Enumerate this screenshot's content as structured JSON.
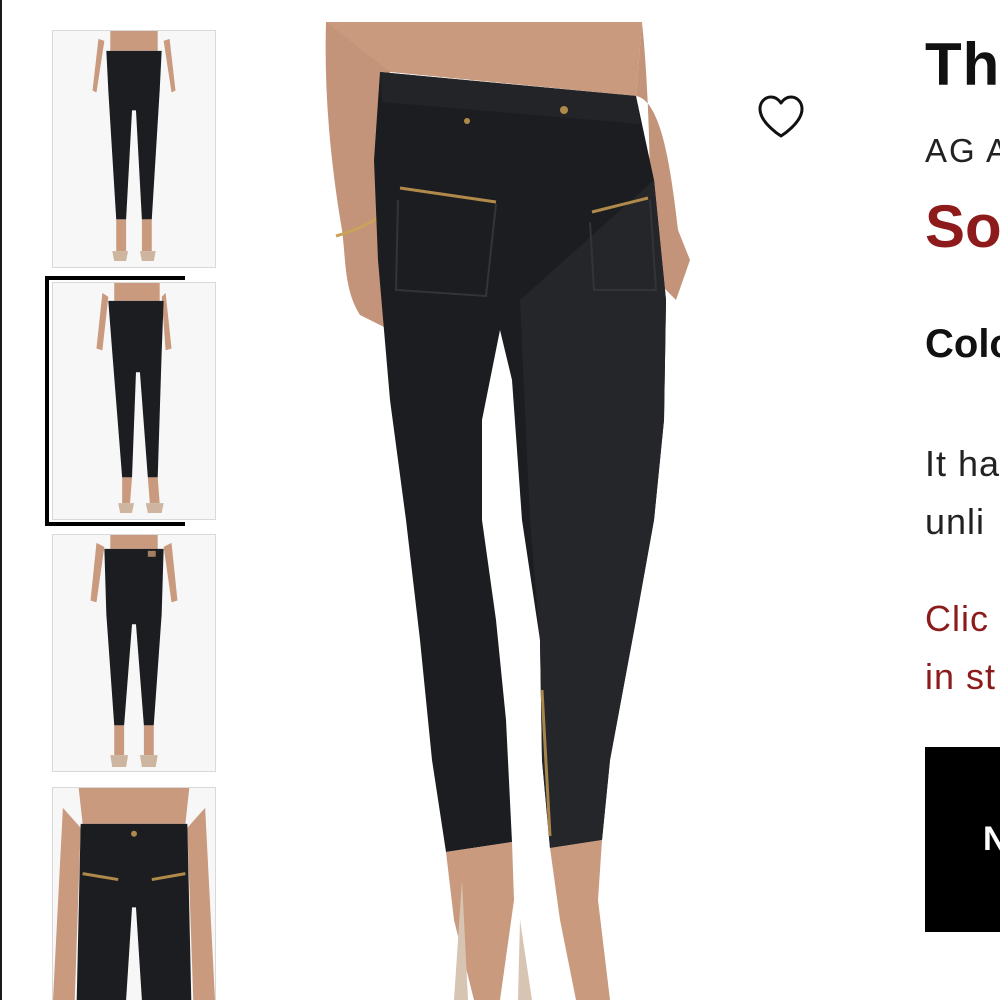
{
  "gallery": {
    "thumbnails": [
      {
        "view": "front",
        "selected": false
      },
      {
        "view": "side",
        "selected": true
      },
      {
        "view": "back",
        "selected": false
      },
      {
        "view": "front-closeup",
        "selected": false
      }
    ]
  },
  "main_image": {
    "view": "side"
  },
  "favorite": {
    "icon": "heart-outline-icon"
  },
  "product": {
    "title": "Th",
    "brand": "AG A",
    "status": "So",
    "color_label": "Colo",
    "description_line1": "It ha",
    "description_line2": "unli",
    "note_line1": "Clic",
    "note_line2": "in st",
    "button_label": "N"
  },
  "colors": {
    "accent": "#8e1b1b",
    "denim": "#1c1d20",
    "skin": "#c99a7e",
    "button": "#000000"
  }
}
